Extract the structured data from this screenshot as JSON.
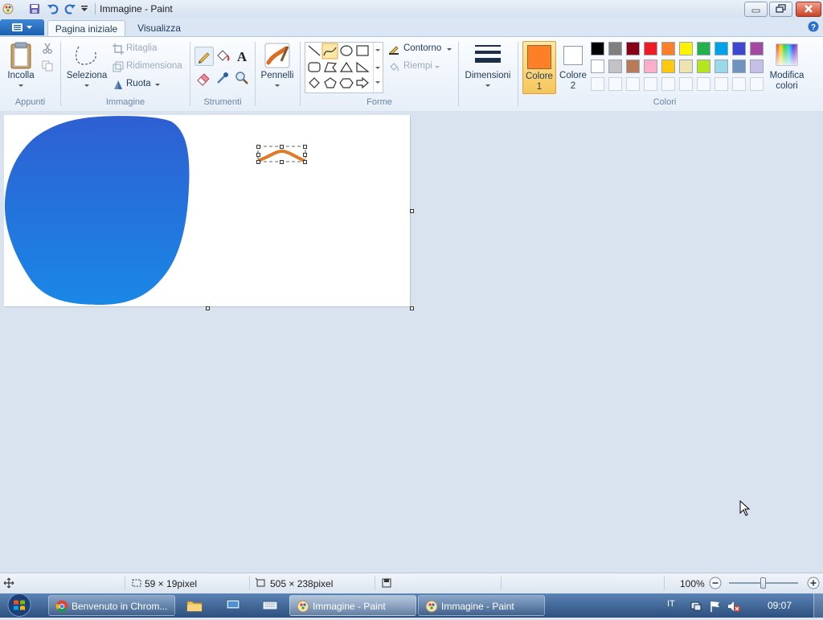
{
  "window": {
    "title": "Immagine - Paint"
  },
  "tabs": [
    {
      "label": "Pagina iniziale",
      "active": true
    },
    {
      "label": "Visualizza",
      "active": false
    }
  ],
  "ribbon": {
    "appunti": {
      "group_label": "Appunti",
      "paste_label": "Incolla"
    },
    "immagine": {
      "group_label": "Immagine",
      "select_label": "Seleziona",
      "crop_label": "Ritaglia",
      "resize_label": "Ridimensiona",
      "rotate_label": "Ruota"
    },
    "strumenti": {
      "group_label": "Strumenti"
    },
    "pennelli": {
      "label": "Pennelli"
    },
    "forme": {
      "group_label": "Forme",
      "outline_label": "Contorno",
      "fill_label": "Riempi"
    },
    "dimensioni": {
      "label": "Dimensioni"
    },
    "colori": {
      "group_label": "Colori",
      "color1_label": "Colore",
      "color1_num": "1",
      "color2_label": "Colore",
      "color2_num": "2",
      "edit_label": "Modifica",
      "edit_label2": "colori",
      "color1": "#ff7f27",
      "color2": "#ffffff",
      "palette_row1": [
        "#000000",
        "#7f7f7f",
        "#880015",
        "#ed1c24",
        "#ff7f27",
        "#fff200",
        "#22b14c",
        "#00a2e8",
        "#3f48cc",
        "#a349a4"
      ],
      "palette_row2": [
        "#ffffff",
        "#c3c3c3",
        "#b97a57",
        "#ffaec9",
        "#ffc90e",
        "#efe4b0",
        "#b5e61d",
        "#99d9ea",
        "#7092be",
        "#c8bfe7"
      ]
    }
  },
  "canvas": {
    "blob_color_top": "#2e5fd3",
    "blob_color_bottom": "#1a87e6",
    "stroke_color": "#e07a2a"
  },
  "status": {
    "selection_size": "59 × 19pixel",
    "canvas_size": "505 × 238pixel",
    "zoom": "100%"
  },
  "taskbar": {
    "chrome_label": "Benvenuto in Chrom...",
    "paint_label_1": "Immagine - Paint",
    "paint_label_2": "Immagine - Paint",
    "lang": "IT",
    "clock": "09:07"
  }
}
